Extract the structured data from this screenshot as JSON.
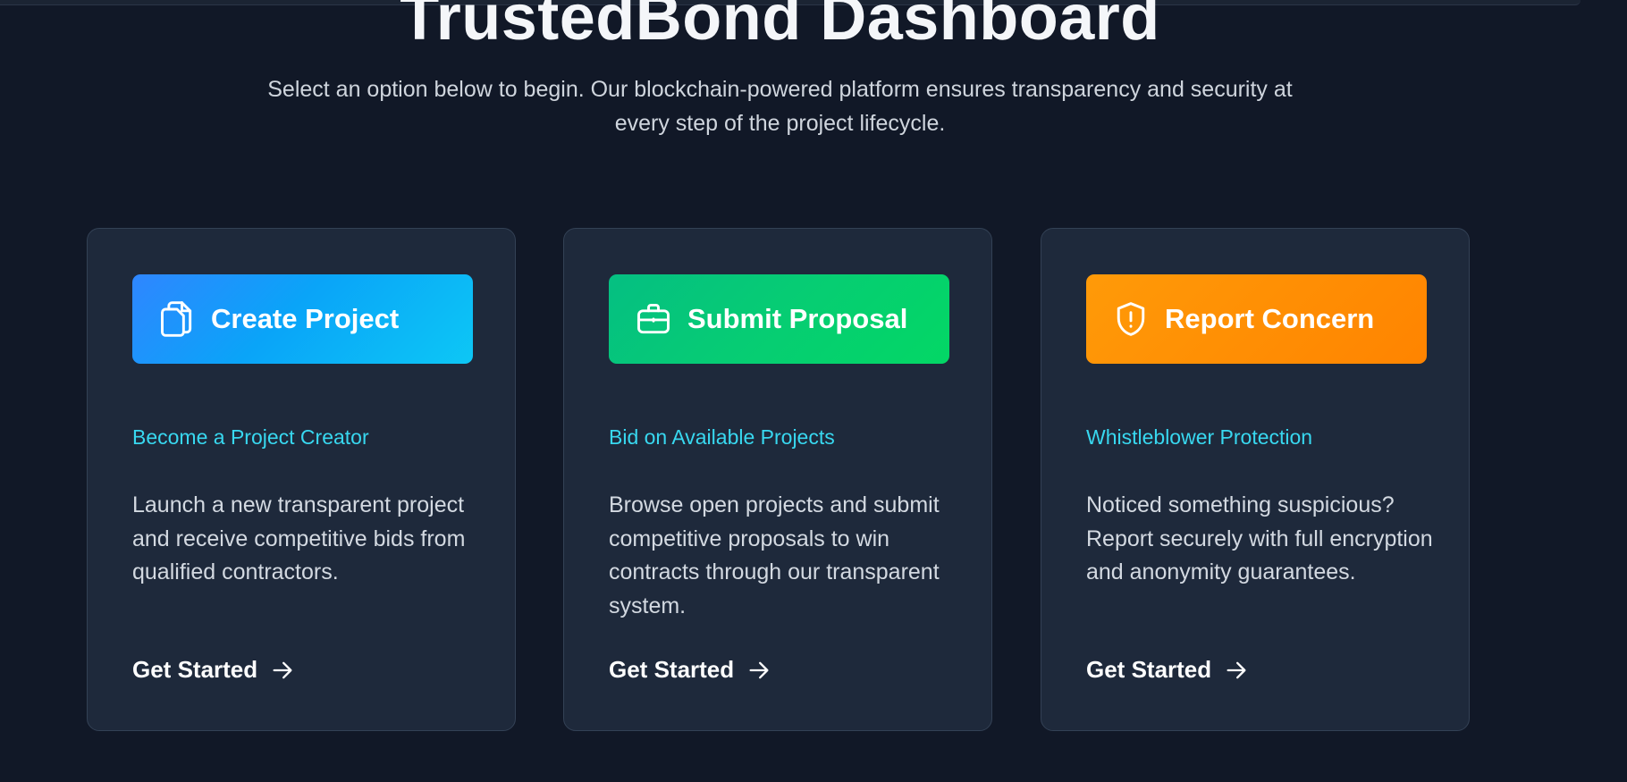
{
  "header": {
    "title": "TrustedBond Dashboard",
    "subtitle": "Select an option below to begin. Our blockchain-powered platform ensures transparency and security at every step of the project lifecycle."
  },
  "cards": [
    {
      "button_label": "Create Project",
      "button_icon": "documents-icon",
      "accent": "#0aa4f8",
      "subtitle": "Become a Project Creator",
      "description": "Launch a new transparent project and receive competitive bids from qualified contractors.",
      "cta": "Get Started"
    },
    {
      "button_label": "Submit Proposal",
      "button_icon": "briefcase-icon",
      "accent": "#06cd73",
      "subtitle": "Bid on Available Projects",
      "description": "Browse open projects and submit competitive proposals to win contracts through our transparent system.",
      "cta": "Get Started"
    },
    {
      "button_label": "Report Concern",
      "button_icon": "shield-alert-icon",
      "accent": "#ff8f04",
      "subtitle": "Whistleblower Protection",
      "description": "Noticed something suspicious? Report securely with full encryption and anonymity guarantees.",
      "cta": "Get Started"
    }
  ],
  "colors": {
    "background": "#111827",
    "card": "#1e293b",
    "card_border": "#334155",
    "subtitle_accent": "#38d8f0"
  }
}
